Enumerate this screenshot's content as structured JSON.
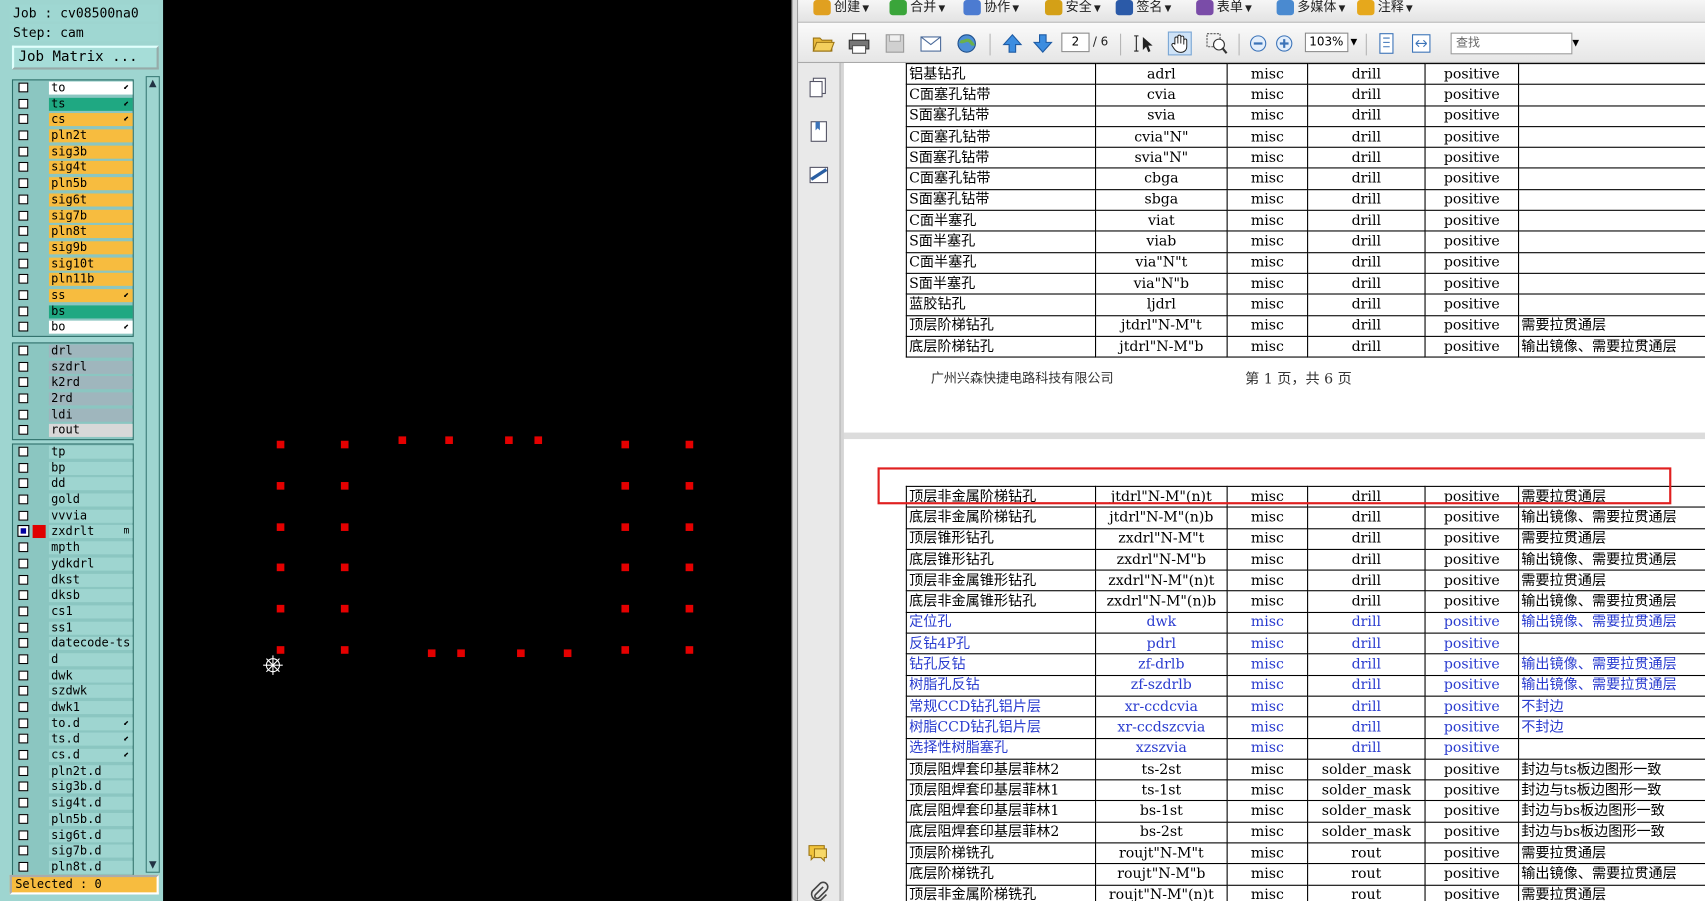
{
  "cam": {
    "job_line": "Job : cv08500na0",
    "step_line": "Step: cam",
    "job_matrix_label": "Job Matrix ...",
    "selected_label": "Selected : 0",
    "groups": [
      {
        "layers": [
          {
            "name": "to",
            "color": "#ffffff",
            "flag": "⬋"
          },
          {
            "name": "ts",
            "color": "#1fa882",
            "flag": "⬋"
          },
          {
            "name": "cs",
            "color": "#f7bc3f",
            "flag": "⬋"
          },
          {
            "name": "pln2t",
            "color": "#f7bc3f",
            "flag": ""
          },
          {
            "name": "sig3b",
            "color": "#f7bc3f",
            "flag": ""
          },
          {
            "name": "sig4t",
            "color": "#f7bc3f",
            "flag": ""
          },
          {
            "name": "pln5b",
            "color": "#f7bc3f",
            "flag": ""
          },
          {
            "name": "sig6t",
            "color": "#f7bc3f",
            "flag": ""
          },
          {
            "name": "sig7b",
            "color": "#f7bc3f",
            "flag": ""
          },
          {
            "name": "pln8t",
            "color": "#f7bc3f",
            "flag": ""
          },
          {
            "name": "sig9b",
            "color": "#f7bc3f",
            "flag": ""
          },
          {
            "name": "sig10t",
            "color": "#f7bc3f",
            "flag": ""
          },
          {
            "name": "pln11b",
            "color": "#f7bc3f",
            "flag": ""
          },
          {
            "name": "ss",
            "color": "#f7bc3f",
            "flag": "⬋"
          },
          {
            "name": "bs",
            "color": "#1fa882",
            "flag": ""
          },
          {
            "name": "bo",
            "color": "#ffffff",
            "flag": "⬋"
          }
        ]
      },
      {
        "layers": [
          {
            "name": "drl",
            "color": "#9fb6bd",
            "flag": ""
          },
          {
            "name": "szdrl",
            "color": "#9fb6bd",
            "flag": ""
          },
          {
            "name": "k2rd",
            "color": "#9fb6bd",
            "flag": ""
          },
          {
            "name": "2rd",
            "color": "#9fb6bd",
            "flag": ""
          },
          {
            "name": "ldi",
            "color": "#9fb6bd",
            "flag": ""
          },
          {
            "name": "rout",
            "color": "#d8d8d8",
            "flag": ""
          }
        ]
      },
      {
        "layers": [
          {
            "name": "tp",
            "color": "#9ed5d0",
            "flag": ""
          },
          {
            "name": "bp",
            "color": "#9ed5d0",
            "flag": ""
          },
          {
            "name": "dd",
            "color": "#9ed5d0",
            "flag": ""
          },
          {
            "name": "gold",
            "color": "#9ed5d0",
            "flag": ""
          },
          {
            "name": "vvvia",
            "color": "#9ed5d0",
            "flag": ""
          },
          {
            "name": "zxdrlt",
            "color": "#9ed5d0",
            "flag": "m",
            "active": true
          },
          {
            "name": "mpth",
            "color": "#9ed5d0",
            "flag": ""
          },
          {
            "name": "ydkdrl",
            "color": "#9ed5d0",
            "flag": ""
          },
          {
            "name": "dkst",
            "color": "#9ed5d0",
            "flag": ""
          },
          {
            "name": "dksb",
            "color": "#9ed5d0",
            "flag": ""
          },
          {
            "name": "cs1",
            "color": "#9ed5d0",
            "flag": ""
          },
          {
            "name": "ss1",
            "color": "#9ed5d0",
            "flag": ""
          },
          {
            "name": "datecode-ts",
            "color": "#9ed5d0",
            "flag": ""
          },
          {
            "name": "d",
            "color": "#9ed5d0",
            "flag": ""
          },
          {
            "name": "dwk",
            "color": "#9ed5d0",
            "flag": ""
          },
          {
            "name": "szdwk",
            "color": "#9ed5d0",
            "flag": ""
          },
          {
            "name": "dwk1",
            "color": "#9ed5d0",
            "flag": ""
          },
          {
            "name": "to.d",
            "color": "#9ed5d0",
            "flag": "⬋"
          },
          {
            "name": "ts.d",
            "color": "#9ed5d0",
            "flag": "⬋"
          },
          {
            "name": "cs.d",
            "color": "#9ed5d0",
            "flag": "⬋"
          },
          {
            "name": "pln2t.d",
            "color": "#9ed5d0",
            "flag": ""
          },
          {
            "name": "sig3b.d",
            "color": "#9ed5d0",
            "flag": ""
          },
          {
            "name": "sig4t.d",
            "color": "#9ed5d0",
            "flag": ""
          },
          {
            "name": "pln5b.d",
            "color": "#9ed5d0",
            "flag": ""
          },
          {
            "name": "sig6t.d",
            "color": "#9ed5d0",
            "flag": ""
          },
          {
            "name": "sig7b.d",
            "color": "#9ed5d0",
            "flag": ""
          },
          {
            "name": "pln8t.d",
            "color": "#9ed5d0",
            "flag": ""
          }
        ]
      }
    ]
  },
  "viewer": {
    "menu": [
      "创建",
      "合并",
      "协作",
      "安全",
      "签名",
      "表单",
      "多媒体",
      "注释"
    ],
    "page_current": "2",
    "page_total": "/ 6",
    "zoom": "103%",
    "find_placeholder": "查找"
  },
  "page1_rows": [
    [
      "铝基钻孔",
      "adrl",
      "misc",
      "drill",
      "positive",
      ""
    ],
    [
      "C面塞孔钻带",
      "cvia",
      "misc",
      "drill",
      "positive",
      ""
    ],
    [
      "S面塞孔钻带",
      "svia",
      "misc",
      "drill",
      "positive",
      ""
    ],
    [
      "C面塞孔钻带",
      "cvia\"N\"",
      "misc",
      "drill",
      "positive",
      ""
    ],
    [
      "S面塞孔钻带",
      "svia\"N\"",
      "misc",
      "drill",
      "positive",
      ""
    ],
    [
      "C面塞孔钻带",
      "cbga",
      "misc",
      "drill",
      "positive",
      ""
    ],
    [
      "S面塞孔钻带",
      "sbga",
      "misc",
      "drill",
      "positive",
      ""
    ],
    [
      "C面半塞孔",
      "viat",
      "misc",
      "drill",
      "positive",
      ""
    ],
    [
      "S面半塞孔",
      "viab",
      "misc",
      "drill",
      "positive",
      ""
    ],
    [
      "C面半塞孔",
      "via\"N\"t",
      "misc",
      "drill",
      "positive",
      ""
    ],
    [
      "S面半塞孔",
      "via\"N\"b",
      "misc",
      "drill",
      "positive",
      ""
    ],
    [
      "蓝胶钻孔",
      "ljdrl",
      "misc",
      "drill",
      "positive",
      ""
    ],
    [
      "顶层阶梯钻孔",
      "jtdrl\"N-M\"t",
      "misc",
      "drill",
      "positive",
      "需要拉贯通层"
    ],
    [
      "底层阶梯钻孔",
      "jtdrl\"N-M\"b",
      "misc",
      "drill",
      "positive",
      "输出镜像、需要拉贯通层"
    ]
  ],
  "footer": {
    "company": "广州兴森快捷电路科技有限公司",
    "page_text": "第 1 页，共 6 页"
  },
  "page2_rows": [
    {
      "cells": [
        "顶层非金属阶梯钻孔",
        "jtdrl\"N-M\"(n)t",
        "misc",
        "drill",
        "positive",
        "需要拉贯通层"
      ],
      "blue": false
    },
    {
      "cells": [
        "底层非金属阶梯钻孔",
        "jtdrl\"N-M\"(n)b",
        "misc",
        "drill",
        "positive",
        "输出镜像、需要拉贯通层"
      ],
      "blue": false
    },
    {
      "cells": [
        "顶层锥形钻孔",
        "zxdrl\"N-M\"t",
        "misc",
        "drill",
        "positive",
        "需要拉贯通层"
      ],
      "blue": false
    },
    {
      "cells": [
        "底层锥形钻孔",
        "zxdrl\"N-M\"b",
        "misc",
        "drill",
        "positive",
        "输出镜像、需要拉贯通层"
      ],
      "blue": false
    },
    {
      "cells": [
        "顶层非金属锥形钻孔",
        "zxdrl\"N-M\"(n)t",
        "misc",
        "drill",
        "positive",
        "需要拉贯通层"
      ],
      "blue": false
    },
    {
      "cells": [
        "底层非金属锥形钻孔",
        "zxdrl\"N-M\"(n)b",
        "misc",
        "drill",
        "positive",
        "输出镜像、需要拉贯通层"
      ],
      "blue": false
    },
    {
      "cells": [
        "定位孔",
        "dwk",
        "misc",
        "drill",
        "positive",
        "输出镜像、需要拉贯通层"
      ],
      "blue": true
    },
    {
      "cells": [
        "反钻4P孔",
        "pdrl",
        "misc",
        "drill",
        "positive",
        ""
      ],
      "blue": true
    },
    {
      "cells": [
        "钻孔反钻",
        "zf-drlb",
        "misc",
        "drill",
        "positive",
        "输出镜像、需要拉贯通层"
      ],
      "blue": true
    },
    {
      "cells": [
        "树脂孔反钻",
        "zf-szdrlb",
        "misc",
        "drill",
        "positive",
        "输出镜像、需要拉贯通层"
      ],
      "blue": true
    },
    {
      "cells": [
        "常规CCD钻孔铝片层",
        "xr-ccdcvia",
        "misc",
        "drill",
        "positive",
        "不封边"
      ],
      "blue": true
    },
    {
      "cells": [
        "树脂CCD钻孔铝片层",
        "xr-ccdszcvia",
        "misc",
        "drill",
        "positive",
        "不封边"
      ],
      "blue": true
    },
    {
      "cells": [
        "选择性树脂塞孔",
        "xzszvia",
        "misc",
        "drill",
        "positive",
        ""
      ],
      "blue": true
    },
    {
      "cells": [
        "顶层阻焊套印基层菲林2",
        "ts-2st",
        "misc",
        "solder_mask",
        "positive",
        "封边与ts板边图形一致"
      ],
      "blue": false
    },
    {
      "cells": [
        "顶层阻焊套印基层菲林1",
        "ts-1st",
        "misc",
        "solder_mask",
        "positive",
        "封边与ts板边图形一致"
      ],
      "blue": false
    },
    {
      "cells": [
        "底层阻焊套印基层菲林1",
        "bs-1st",
        "misc",
        "solder_mask",
        "positive",
        "封边与bs板边图形一致"
      ],
      "blue": false
    },
    {
      "cells": [
        "底层阻焊套印基层菲林2",
        "bs-2st",
        "misc",
        "solder_mask",
        "positive",
        "封边与bs板边图形一致"
      ],
      "blue": false
    },
    {
      "cells": [
        "顶层阶梯铣孔",
        "roujt\"N-M\"t",
        "misc",
        "rout",
        "positive",
        "需要拉贯通层"
      ],
      "blue": false
    },
    {
      "cells": [
        "底层阶梯铣孔",
        "roujt\"N-M\"b",
        "misc",
        "rout",
        "positive",
        "输出镜像、需要拉贯通层"
      ],
      "blue": false
    },
    {
      "cells": [
        "顶层非金属阶梯铣孔",
        "roujt\"N-M\"(n)t",
        "misc",
        "rout",
        "positive",
        "需要拉贯通层"
      ],
      "blue": false
    }
  ],
  "colors": {
    "pad": "#e40000",
    "highlight": "#e02020",
    "link_blue": "#2a3ccf"
  },
  "icons": [
    "crosshair-icon",
    "open-folder-icon",
    "print-icon",
    "save-icon",
    "email-icon",
    "globe-icon",
    "page-up-icon",
    "page-down-icon",
    "select-text-icon",
    "hand-tool-icon",
    "zoom-tool-icon",
    "zoom-out-icon",
    "zoom-in-icon",
    "fit-page-icon",
    "fit-width-icon",
    "pages-icon",
    "bookmarks-icon",
    "signatures-icon",
    "comments-icon",
    "attachments-icon"
  ]
}
